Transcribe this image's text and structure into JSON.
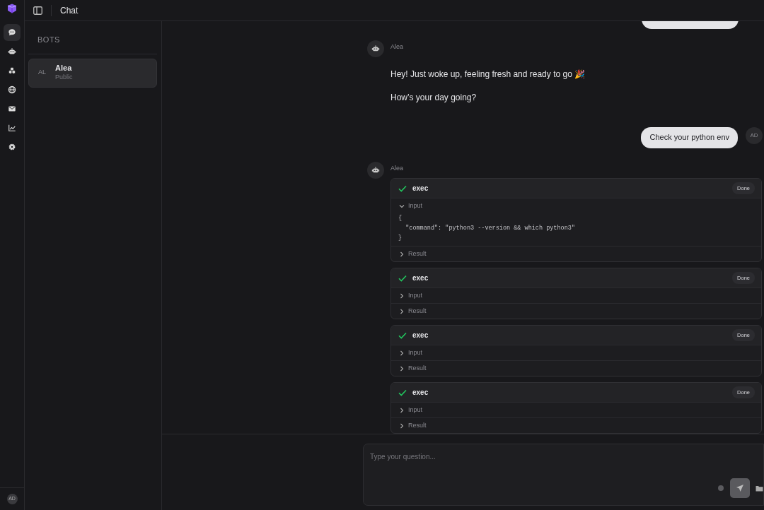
{
  "header": {
    "title": "Chat"
  },
  "rail": {
    "items": [
      {
        "kind": "chat",
        "selected": true
      },
      {
        "kind": "robot",
        "selected": false
      },
      {
        "kind": "cluster",
        "selected": false
      },
      {
        "kind": "globe",
        "selected": false
      },
      {
        "kind": "mail",
        "selected": false
      },
      {
        "kind": "chart",
        "selected": false
      },
      {
        "kind": "settings",
        "selected": false
      }
    ],
    "user_initials": "AD"
  },
  "sidebar": {
    "heading": "BOTS",
    "bots": [
      {
        "initials": "AL",
        "name": "Alea",
        "visibility": "Public",
        "selected": true
      }
    ]
  },
  "messages": [
    {
      "kind": "user_clipped"
    },
    {
      "kind": "bot",
      "sender": "Alea",
      "paragraphs": [
        "Hey! Just woke up, feeling fresh and ready to go 🎉",
        "How’s your day going?"
      ]
    },
    {
      "kind": "user",
      "text": "Check your python env",
      "initials": "AD"
    },
    {
      "kind": "tools",
      "sender": "Alea",
      "calls": [
        {
          "name": "exec",
          "status": "Done",
          "sections": [
            {
              "label": "Input",
              "expanded": true,
              "code": "{\n  \"command\": \"python3 --version && which python3\"\n}"
            },
            {
              "label": "Result",
              "expanded": false
            }
          ]
        },
        {
          "name": "exec",
          "status": "Done",
          "sections": [
            {
              "label": "Input",
              "expanded": false
            },
            {
              "label": "Result",
              "expanded": false
            }
          ]
        },
        {
          "name": "exec",
          "status": "Done",
          "sections": [
            {
              "label": "Input",
              "expanded": false
            },
            {
              "label": "Result",
              "expanded": false
            }
          ]
        },
        {
          "name": "exec",
          "status": "Done",
          "sections": [
            {
              "label": "Input",
              "expanded": false
            },
            {
              "label": "Result",
              "expanded": false
            }
          ]
        }
      ]
    }
  ],
  "composer": {
    "placeholder": "Type your question..."
  }
}
